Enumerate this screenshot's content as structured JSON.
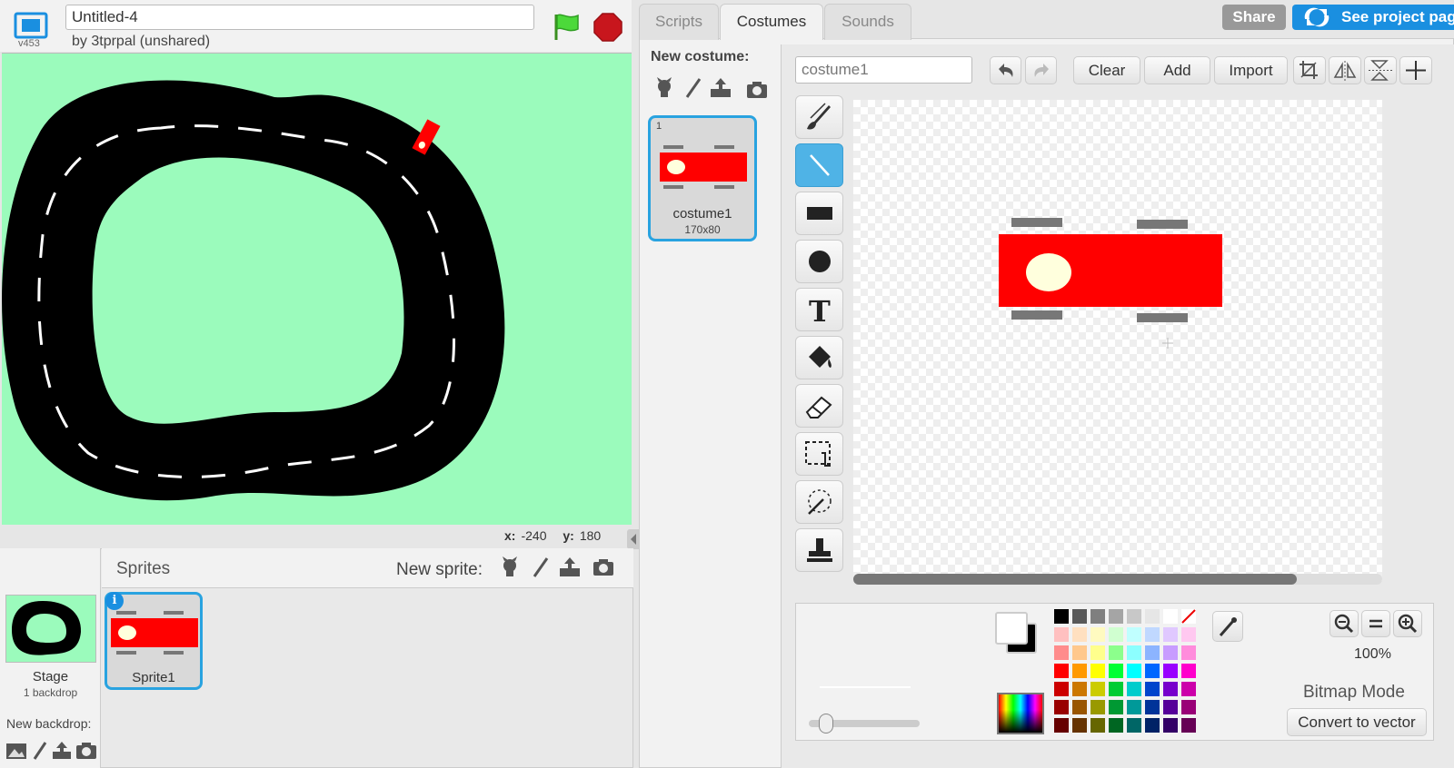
{
  "header": {
    "version": "v453",
    "project_title": "Untitled-4",
    "byline": "by 3tprpal (unshared)"
  },
  "stage": {
    "coords": {
      "x_label": "x:",
      "x_value": "-240",
      "y_label": "y:",
      "y_value": "180"
    },
    "background_color": "#9bfbbc"
  },
  "sprites_panel": {
    "title": "Sprites",
    "new_sprite_label": "New sprite:",
    "stage_label": "Stage",
    "backdrop_count": "1 backdrop",
    "new_backdrop_label": "New backdrop:",
    "sprites": [
      {
        "name": "Sprite1",
        "info": "i"
      }
    ]
  },
  "tabs": [
    {
      "label": "Scripts"
    },
    {
      "label": "Costumes"
    },
    {
      "label": "Sounds"
    }
  ],
  "top_right": {
    "share_label": "Share",
    "see_project_label": "See project page"
  },
  "costumes": {
    "new_costume_label": "New costume:",
    "items": [
      {
        "number": "1",
        "name": "costume1",
        "size": "170x80"
      }
    ]
  },
  "editor": {
    "costume_name_value": "costume1",
    "clear_label": "Clear",
    "add_label": "Add",
    "import_label": "Import",
    "zoom_level": "100%",
    "mode_label": "Bitmap Mode",
    "convert_label": "Convert to vector",
    "tools": [
      "brush-icon",
      "line-icon",
      "rectangle-icon",
      "ellipse-icon",
      "text-icon",
      "fill-icon",
      "eraser-icon",
      "select-icon",
      "magic-wand-icon",
      "stamp-icon"
    ],
    "active_tool": "line-icon",
    "palette": [
      [
        "#000000",
        "#595959",
        "#7f7f7f",
        "#a5a5a5",
        "#c8c8c8",
        "#e6e6e6",
        "#ffffff",
        "none"
      ],
      [
        "#ffc0c0",
        "#ffe0c0",
        "#fffac0",
        "#d0ffd0",
        "#c0ffff",
        "#c0d8ff",
        "#e0c8ff",
        "#ffc8f0"
      ],
      [
        "#ff8c8c",
        "#ffc88c",
        "#ffff8c",
        "#8cff8c",
        "#8cffff",
        "#8cb4ff",
        "#c89cff",
        "#ff8cdc"
      ],
      [
        "#ff0000",
        "#ff9900",
        "#ffff00",
        "#00ff33",
        "#00ffff",
        "#0066ff",
        "#9900ff",
        "#ff00cc"
      ],
      [
        "#cc0000",
        "#cc7700",
        "#cccc00",
        "#00cc33",
        "#00cccc",
        "#0044cc",
        "#7700cc",
        "#cc00aa"
      ],
      [
        "#990000",
        "#995500",
        "#999900",
        "#009933",
        "#009999",
        "#003399",
        "#550099",
        "#990077"
      ],
      [
        "#660000",
        "#663300",
        "#666600",
        "#006622",
        "#006666",
        "#002266",
        "#330066",
        "#660055"
      ]
    ]
  }
}
